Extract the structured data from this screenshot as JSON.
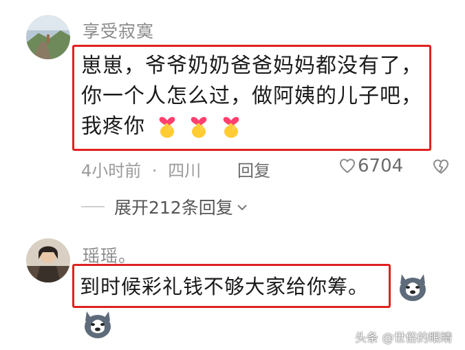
{
  "comments": [
    {
      "username": "享受寂寞",
      "lines": [
        "崽崽，爷爷奶奶爸爸妈妈都没有了，",
        "你一个人怎么过，做阿姨的儿子吧，",
        "我疼你"
      ],
      "emoji_icon": "heart-hands-emoji",
      "emoji_count": 3,
      "time": "4小时前",
      "separator": "·",
      "location": "四川",
      "reply_label": "回复",
      "like_count": "6704",
      "expand_label": "展开212条回复"
    },
    {
      "username": "瑶瑶。",
      "text": "到时候彩礼钱不够大家给你筹。",
      "sticker_icon": "husky-dog-sticker"
    }
  ],
  "watermark": "头条 @世俗的眼睛",
  "colors": {
    "highlight": "#e02020",
    "muted": "#9a9a9a",
    "text": "#1a1a1a"
  }
}
